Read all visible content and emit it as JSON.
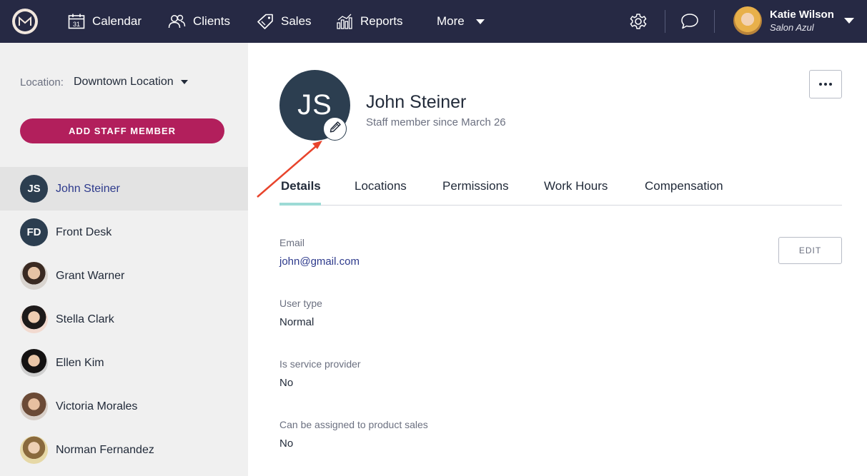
{
  "nav": {
    "items": [
      {
        "label": "Calendar",
        "icon": "calendar-icon"
      },
      {
        "label": "Clients",
        "icon": "clients-icon"
      },
      {
        "label": "Sales",
        "icon": "tag-icon"
      },
      {
        "label": "Reports",
        "icon": "bar-chart-icon"
      },
      {
        "label": "More",
        "icon": "chevron-down-icon"
      }
    ],
    "user": {
      "name": "Katie Wilson",
      "business": "Salon Azul"
    },
    "calendar_day": "31"
  },
  "sidebar": {
    "location_label": "Location:",
    "location_value": "Downtown Location",
    "add_button": "ADD STAFF MEMBER",
    "staff": [
      {
        "name": "John Steiner",
        "initials": "JS"
      },
      {
        "name": "Front Desk",
        "initials": "FD"
      },
      {
        "name": "Grant Warner"
      },
      {
        "name": "Stella Clark"
      },
      {
        "name": "Ellen Kim"
      },
      {
        "name": "Victoria Morales"
      },
      {
        "name": "Norman Fernandez"
      }
    ]
  },
  "profile": {
    "initials": "JS",
    "name": "John Steiner",
    "since": "Staff member since March 26"
  },
  "tabs": [
    "Details",
    "Locations",
    "Permissions",
    "Work Hours",
    "Compensation"
  ],
  "details": {
    "edit_button": "EDIT",
    "fields": [
      {
        "label": "Email",
        "value": "john@gmail.com"
      },
      {
        "label": "User type",
        "value": "Normal"
      },
      {
        "label": "Is service provider",
        "value": "No"
      },
      {
        "label": "Can be assigned to product sales",
        "value": "No"
      }
    ]
  },
  "colors": {
    "nav_bg": "#262944",
    "accent_button": "#b21f5c",
    "tab_underline": "#9ddbd6",
    "link": "#2d3a8c",
    "annotation_arrow": "#e8442c"
  }
}
